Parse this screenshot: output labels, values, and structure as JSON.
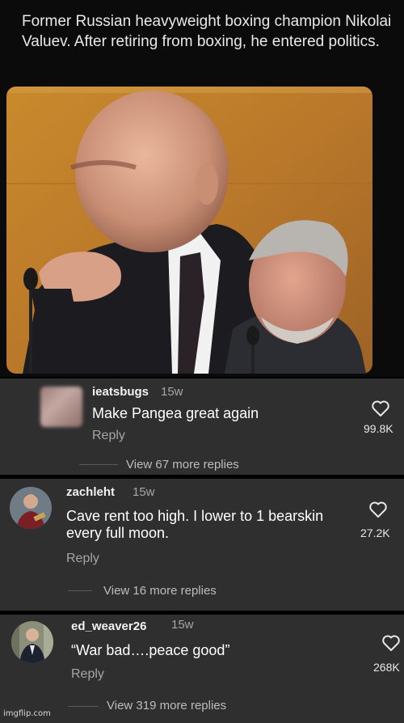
{
  "tweet": {
    "text": "Former Russian heavyweight boxing champion Nikolai Valuev. After retiring from boxing, he entered politics."
  },
  "comments": [
    {
      "username": "ieatsbugs",
      "age": "15w",
      "text": "Make Pangea great again",
      "reply_label": "Reply",
      "likes": "99.8K",
      "more_replies": "View 67 more replies"
    },
    {
      "username": "zachleht",
      "age": "15w",
      "text": "Cave rent too high. I lower to 1 bearskin every full moon.",
      "reply_label": "Reply",
      "likes": "27.2K",
      "more_replies": "View 16 more replies"
    },
    {
      "username": "ed_weaver26",
      "age": "15w",
      "text": "“War bad….peace good”",
      "reply_label": "Reply",
      "likes": "268K",
      "more_replies": "View 319 more replies"
    }
  ],
  "watermark": "imgflip.com",
  "colors": {
    "background": "#000000",
    "card_background": "#2f2f2f",
    "secondary_text": "#a6a6a6"
  },
  "icons": {
    "like": "heart-outline-icon"
  }
}
